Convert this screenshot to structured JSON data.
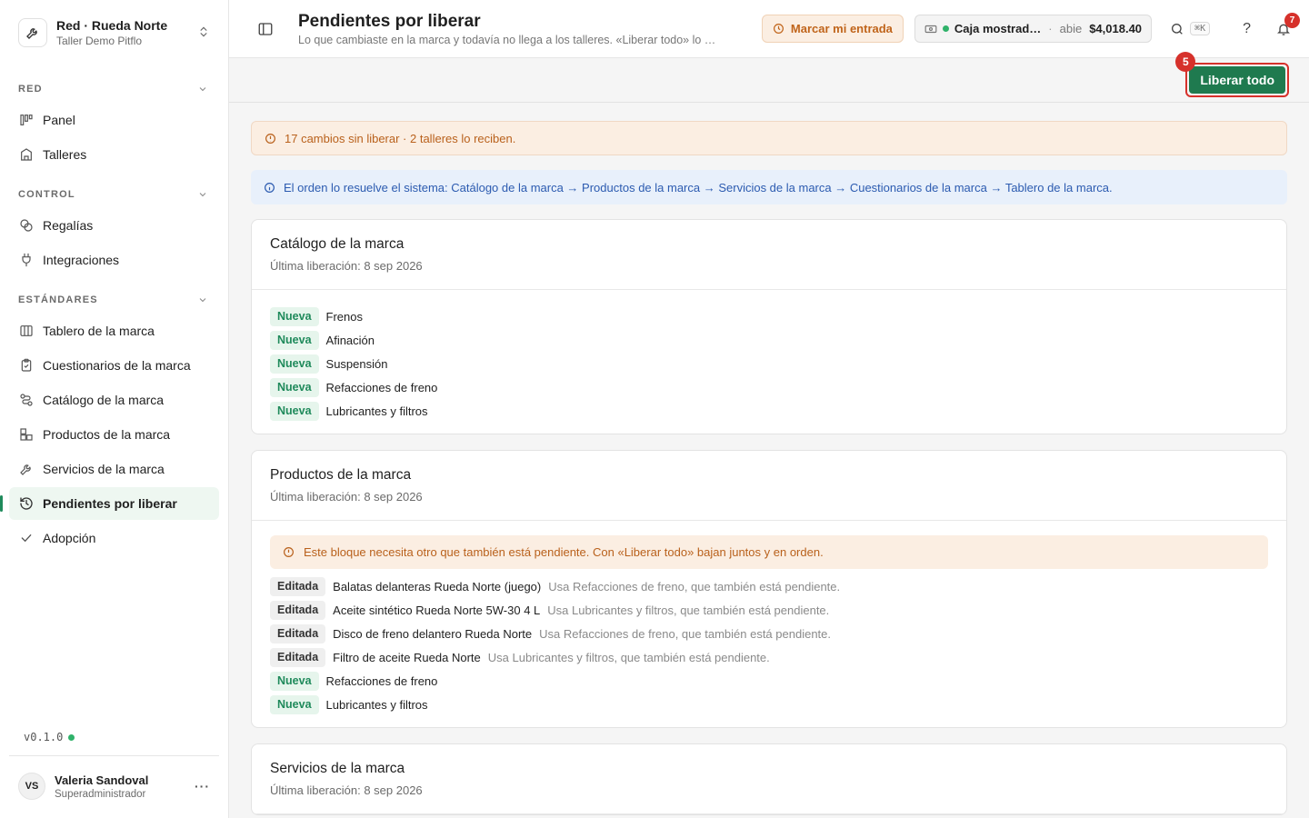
{
  "org": {
    "name": "Red · Rueda Norte",
    "subtitle": "Taller Demo Pitflo"
  },
  "sidebar": {
    "sections": [
      {
        "label": "RED",
        "items": [
          {
            "label": "Panel",
            "icon": "panel-icon"
          },
          {
            "label": "Talleres",
            "icon": "building-icon"
          }
        ]
      },
      {
        "label": "CONTROL",
        "items": [
          {
            "label": "Regalías",
            "icon": "coins-icon"
          },
          {
            "label": "Integraciones",
            "icon": "plug-icon"
          }
        ]
      },
      {
        "label": "ESTÁNDARES",
        "items": [
          {
            "label": "Tablero de la marca",
            "icon": "columns-icon"
          },
          {
            "label": "Cuestionarios de la marca",
            "icon": "clipboard-icon"
          },
          {
            "label": "Catálogo de la marca",
            "icon": "route-icon"
          },
          {
            "label": "Productos de la marca",
            "icon": "boxes-icon"
          },
          {
            "label": "Servicios de la marca",
            "icon": "wrench-icon"
          },
          {
            "label": "Pendientes por liberar",
            "icon": "history-icon",
            "active": true
          },
          {
            "label": "Adopción",
            "icon": "check-icon"
          }
        ]
      }
    ],
    "version": "v0.1.0"
  },
  "user": {
    "initials": "VS",
    "name": "Valeria Sandoval",
    "role": "Superadministrador"
  },
  "header": {
    "title": "Pendientes por liberar",
    "subtitle": "Lo que cambiaste en la marca y todavía no llega a los talleres. «Liberar todo» lo …",
    "mark_entry": "Marcar mi entrada",
    "cash": {
      "name": "Caja mostrad…",
      "state": "abie",
      "amount": "$4,018.40"
    },
    "shortcut": "⌘K",
    "help": "?",
    "notifications": "7"
  },
  "actions": {
    "release_all": "Liberar todo",
    "badge": "5"
  },
  "alerts": {
    "summary": "17 cambios sin liberar · 2 talleres lo reciben.",
    "order": "El orden lo resuelve el sistema: Catálogo de la marca → Productos de la marca → Servicios de la marca → Cuestionarios de la marca → Tablero de la marca."
  },
  "cards": [
    {
      "title": "Catálogo de la marca",
      "subtitle": "Última liberación: 8 sep 2026",
      "rows": [
        {
          "tag": "Nueva",
          "name": "Frenos",
          "note": ""
        },
        {
          "tag": "Nueva",
          "name": "Afinación",
          "note": ""
        },
        {
          "tag": "Nueva",
          "name": "Suspensión",
          "note": ""
        },
        {
          "tag": "Nueva",
          "name": "Refacciones de freno",
          "note": ""
        },
        {
          "tag": "Nueva",
          "name": "Lubricantes y filtros",
          "note": ""
        }
      ]
    },
    {
      "title": "Productos de la marca",
      "subtitle": "Última liberación: 8 sep 2026",
      "warning": "Este bloque necesita otro que también está pendiente. Con «Liberar todo» bajan juntos y en orden.",
      "rows": [
        {
          "tag": "Editada",
          "name": "Balatas delanteras Rueda Norte (juego)",
          "note": "Usa Refacciones de freno, que también está pendiente."
        },
        {
          "tag": "Editada",
          "name": "Aceite sintético Rueda Norte 5W-30 4 L",
          "note": "Usa Lubricantes y filtros, que también está pendiente."
        },
        {
          "tag": "Editada",
          "name": "Disco de freno delantero Rueda Norte",
          "note": "Usa Refacciones de freno, que también está pendiente."
        },
        {
          "tag": "Editada",
          "name": "Filtro de aceite Rueda Norte",
          "note": "Usa Lubricantes y filtros, que también está pendiente."
        },
        {
          "tag": "Nueva",
          "name": "Refacciones de freno",
          "note": ""
        },
        {
          "tag": "Nueva",
          "name": "Lubricantes y filtros",
          "note": ""
        }
      ]
    },
    {
      "title": "Servicios de la marca",
      "subtitle": "Última liberación: 8 sep 2026",
      "rows": []
    }
  ],
  "colors": {
    "accent": "#1f7a4f",
    "warning": "#b9611c",
    "info": "#2c5bb0",
    "danger": "#d6312b"
  }
}
